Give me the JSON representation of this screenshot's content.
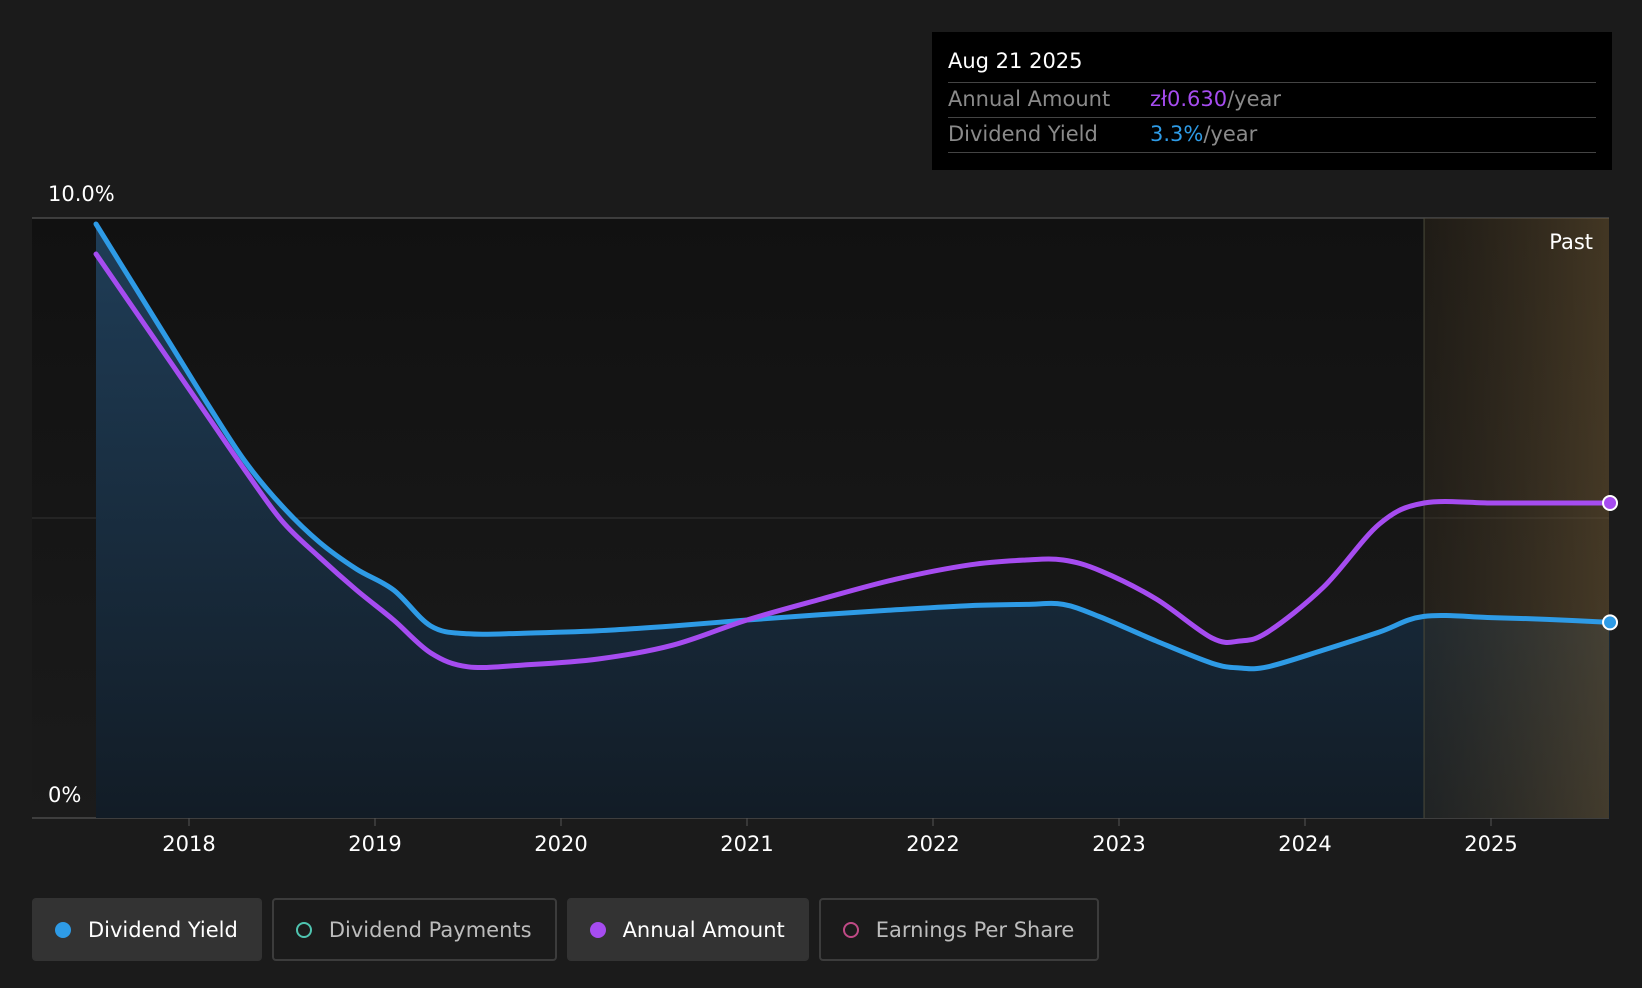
{
  "chart_data": {
    "type": "line",
    "y_axis": {
      "top_label": "10.0%",
      "bottom_label": "0%",
      "ylim": [
        0,
        10
      ]
    },
    "x_ticks": [
      "2018",
      "2019",
      "2020",
      "2021",
      "2022",
      "2023",
      "2024",
      "2025"
    ],
    "xlim": [
      2017.34,
      2025.64
    ],
    "past_start": 2024.64,
    "past_label": "Past",
    "grid": true,
    "series": [
      {
        "name": "Dividend Yield",
        "color": "#2e9be6",
        "filled": true,
        "x": [
          2017.5,
          2017.7,
          2017.9,
          2018.1,
          2018.3,
          2018.5,
          2018.7,
          2018.9,
          2019.1,
          2019.3,
          2019.5,
          2019.8,
          2020.2,
          2020.6,
          2021.0,
          2021.4,
          2021.8,
          2022.2,
          2022.5,
          2022.7,
          2022.9,
          2023.2,
          2023.5,
          2023.65,
          2023.8,
          2024.1,
          2024.4,
          2024.64,
          2025.0,
          2025.3,
          2025.64
        ],
        "values": [
          9.9,
          8.9,
          7.9,
          6.9,
          5.95,
          5.2,
          4.6,
          4.15,
          3.8,
          3.2,
          3.07,
          3.08,
          3.12,
          3.2,
          3.3,
          3.39,
          3.47,
          3.54,
          3.56,
          3.56,
          3.35,
          2.95,
          2.58,
          2.5,
          2.52,
          2.8,
          3.1,
          3.36,
          3.34,
          3.31,
          3.26
        ]
      },
      {
        "name": "Annual Amount",
        "color": "#a64cf0",
        "filled": false,
        "x": [
          2017.5,
          2017.7,
          2017.9,
          2018.1,
          2018.3,
          2018.5,
          2018.7,
          2018.9,
          2019.1,
          2019.3,
          2019.5,
          2019.8,
          2020.2,
          2020.6,
          2021.0,
          2021.4,
          2021.8,
          2022.2,
          2022.5,
          2022.7,
          2022.9,
          2023.2,
          2023.5,
          2023.65,
          2023.8,
          2024.1,
          2024.4,
          2024.64,
          2025.0,
          2025.3,
          2025.64
        ],
        "values": [
          9.4,
          8.5,
          7.6,
          6.7,
          5.8,
          4.95,
          4.35,
          3.8,
          3.3,
          2.75,
          2.52,
          2.55,
          2.65,
          2.88,
          3.3,
          3.65,
          3.98,
          4.22,
          4.3,
          4.3,
          4.12,
          3.65,
          3.0,
          2.95,
          3.1,
          3.85,
          4.9,
          5.25,
          5.25,
          5.25,
          5.25
        ]
      }
    ]
  },
  "tooltip": {
    "date": "Aug 21 2025",
    "rows": [
      {
        "label": "Annual Amount",
        "value": "zł0.630",
        "unit": "/year",
        "color": "#a64cf0"
      },
      {
        "label": "Dividend Yield",
        "value": "3.3%",
        "unit": "/year",
        "color": "#2e9be6"
      }
    ]
  },
  "legend": [
    {
      "label": "Dividend Yield",
      "color": "#2e9be6",
      "active": true,
      "icon": "filled-dot"
    },
    {
      "label": "Dividend Payments",
      "color": "#4fc4b0",
      "active": false,
      "icon": "hollow-dot"
    },
    {
      "label": "Annual Amount",
      "color": "#a64cf0",
      "active": true,
      "icon": "filled-dot"
    },
    {
      "label": "Earnings Per Share",
      "color": "#c04a86",
      "active": false,
      "icon": "hollow-dot"
    }
  ]
}
